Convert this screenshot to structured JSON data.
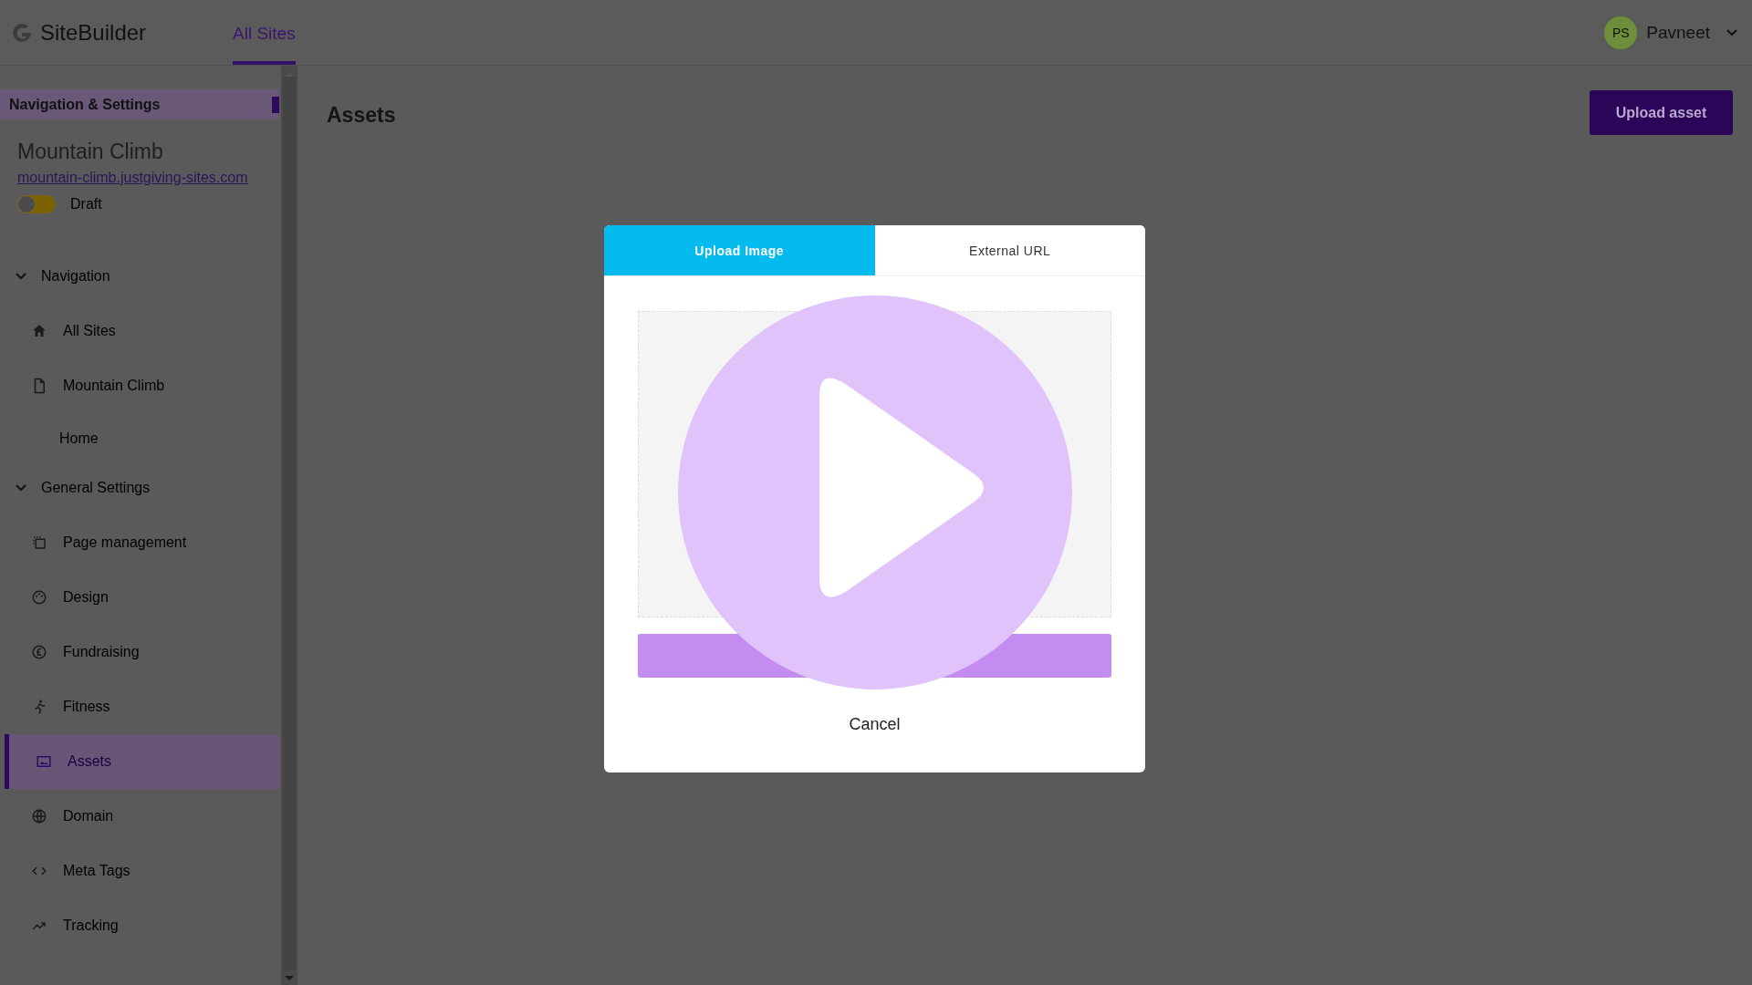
{
  "header": {
    "logo": "SiteBuilder",
    "tabs": [
      {
        "label": "All Sites",
        "selected": true
      }
    ],
    "user": {
      "initials": "PS",
      "name": "Pavneet"
    }
  },
  "sidebar": {
    "title": "Navigation & Settings",
    "site_name": "Mountain Climb",
    "site_url": "mountain-climb.justgiving-sites.com",
    "status": {
      "label": "Draft",
      "on": false
    },
    "sections": [
      {
        "label": "Navigation",
        "expanded": true,
        "items": [
          {
            "label": "All Sites",
            "kind": "home",
            "selected": false
          },
          {
            "label": "Mountain Climb",
            "kind": "page",
            "selected": false,
            "children": [
              {
                "label": "Home",
                "selected": false
              }
            ]
          }
        ]
      },
      {
        "label": "General Settings",
        "expanded": true,
        "items": [
          {
            "label": "Page management",
            "kind": "pages",
            "selected": false
          },
          {
            "label": "Design",
            "kind": "palette",
            "selected": false
          },
          {
            "label": "Fundraising",
            "kind": "currency",
            "selected": false
          },
          {
            "label": "Fitness",
            "kind": "runner",
            "selected": false
          },
          {
            "label": "Assets",
            "kind": "image",
            "selected": true
          },
          {
            "label": "Domain",
            "kind": "globe",
            "selected": false
          },
          {
            "label": "Meta Tags",
            "kind": "code",
            "selected": false
          },
          {
            "label": "Tracking",
            "kind": "trend",
            "selected": false
          }
        ]
      }
    ]
  },
  "main": {
    "title": "Assets",
    "upload_button": "Upload asset"
  },
  "modal": {
    "tabs": [
      {
        "label": "Upload Image",
        "selected": true
      },
      {
        "label": "External URL",
        "selected": false
      }
    ],
    "cancel": "Cancel"
  }
}
